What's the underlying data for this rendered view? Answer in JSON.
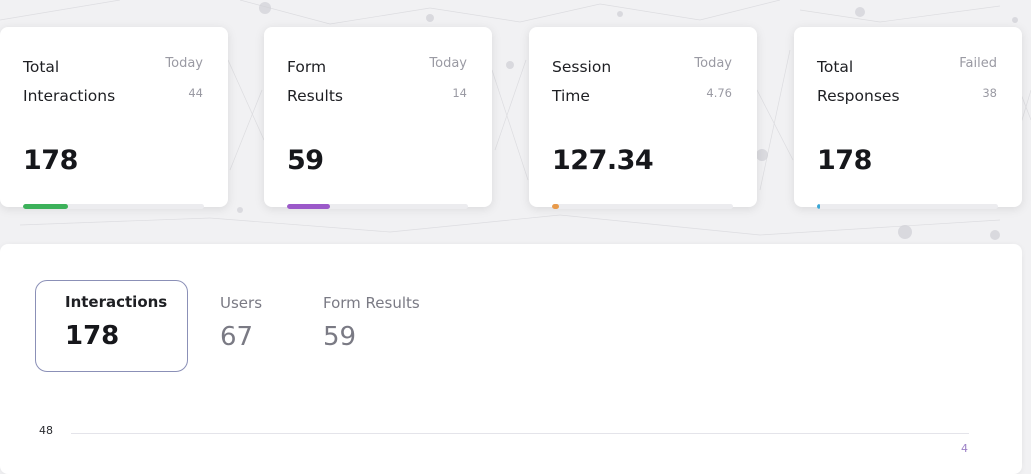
{
  "stats": [
    {
      "title_line1": "Total",
      "title_line2": "Interactions",
      "meta_label": "Today",
      "meta_value": "44",
      "value": "178",
      "progress": 0.25,
      "color": "#3cb15a"
    },
    {
      "title_line1": "Form",
      "title_line2": "Results",
      "meta_label": "Today",
      "meta_value": "14",
      "value": "59",
      "progress": 0.24,
      "color": "#9b59c9"
    },
    {
      "title_line1": "Session",
      "title_line2": "Time",
      "meta_label": "Today",
      "meta_value": "4.76",
      "value": "127.34",
      "progress": 0.04,
      "color": "#e89a4a"
    },
    {
      "title_line1": "Total",
      "title_line2": "Responses",
      "meta_label": "Failed",
      "meta_value": "38",
      "value": "178",
      "progress": 0.015,
      "color": "#3aa7d6"
    }
  ],
  "tabs": [
    {
      "label": "Interactions",
      "value": "178",
      "active": true
    },
    {
      "label": "Users",
      "value": "67",
      "active": false
    },
    {
      "label": "Form Results",
      "value": "59",
      "active": false
    }
  ],
  "chart": {
    "y_tick": "48",
    "point_label": "4"
  }
}
